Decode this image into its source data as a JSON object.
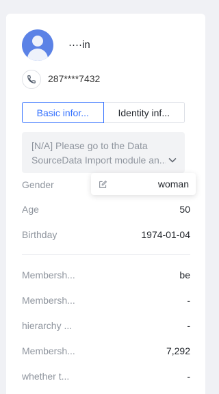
{
  "profile": {
    "name": "····in",
    "phone": "287****7432"
  },
  "tabs": [
    {
      "label": "Basic infor..."
    },
    {
      "label": "Identity inf..."
    }
  ],
  "notice": {
    "line1": "[N/A] Please go to the Data",
    "line2": "SourceData Import module an..."
  },
  "fields": [
    {
      "label": "Gender",
      "value": ""
    },
    {
      "label": "Age",
      "value": "50"
    },
    {
      "label": "Birthday",
      "value": "1974-01-04"
    }
  ],
  "membership": [
    {
      "label": "Membersh...",
      "value": "be"
    },
    {
      "label": "Membersh...",
      "value": "-"
    },
    {
      "label": "hierarchy ...",
      "value": "-"
    },
    {
      "label": "Membersh...",
      "value": "7,292"
    },
    {
      "label": "whether t...",
      "value": "-"
    }
  ],
  "gender_popover": {
    "value": "woman"
  },
  "colors": {
    "accent": "#3370ff",
    "avatar": "#5b82e6"
  }
}
